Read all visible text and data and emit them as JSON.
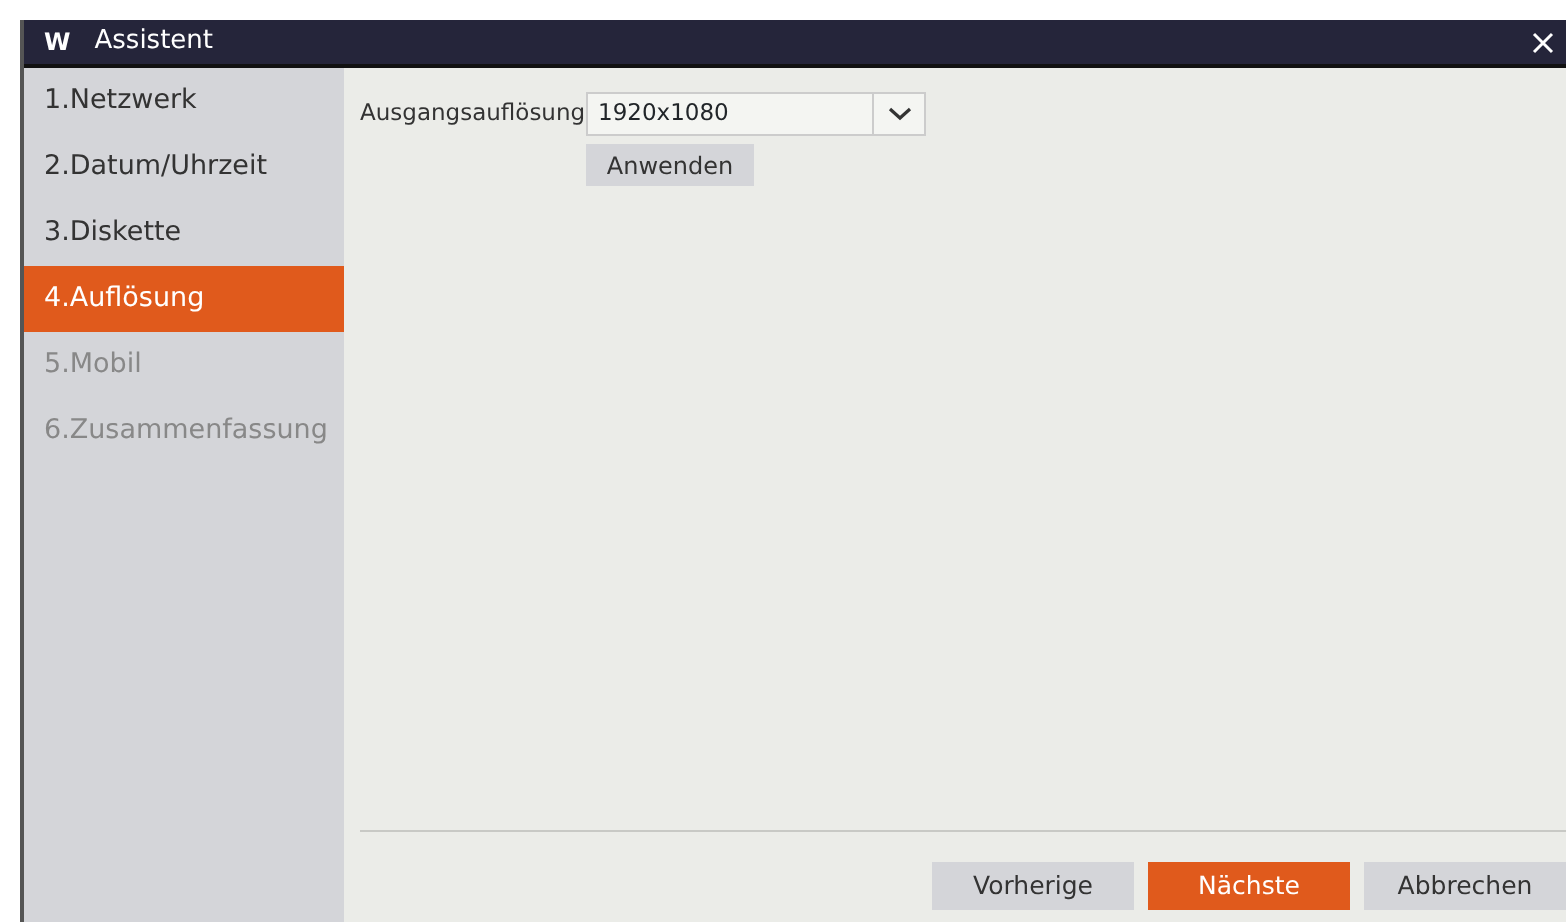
{
  "window": {
    "title": "Assistent",
    "logo": "W"
  },
  "sidebar": {
    "items": [
      {
        "label": "1.Netzwerk",
        "selected": false,
        "disabled": false
      },
      {
        "label": "2.Datum/Uhrzeit",
        "selected": false,
        "disabled": false
      },
      {
        "label": "3.Diskette",
        "selected": false,
        "disabled": false
      },
      {
        "label": "4.Auflösung",
        "selected": true,
        "disabled": false
      },
      {
        "label": "5.Mobil",
        "selected": false,
        "disabled": true
      },
      {
        "label": "6.Zusammenfassung",
        "selected": false,
        "disabled": true
      }
    ]
  },
  "settings": {
    "label": "Ausgangsauflösung",
    "value": "1920x1080",
    "apply_button": "Anwenden"
  },
  "buttons": [
    {
      "label": "Vorherige",
      "kind": "default"
    },
    {
      "label": "Nächste",
      "kind": "primary"
    },
    {
      "label": "Abbrechen",
      "kind": "default"
    }
  ]
}
